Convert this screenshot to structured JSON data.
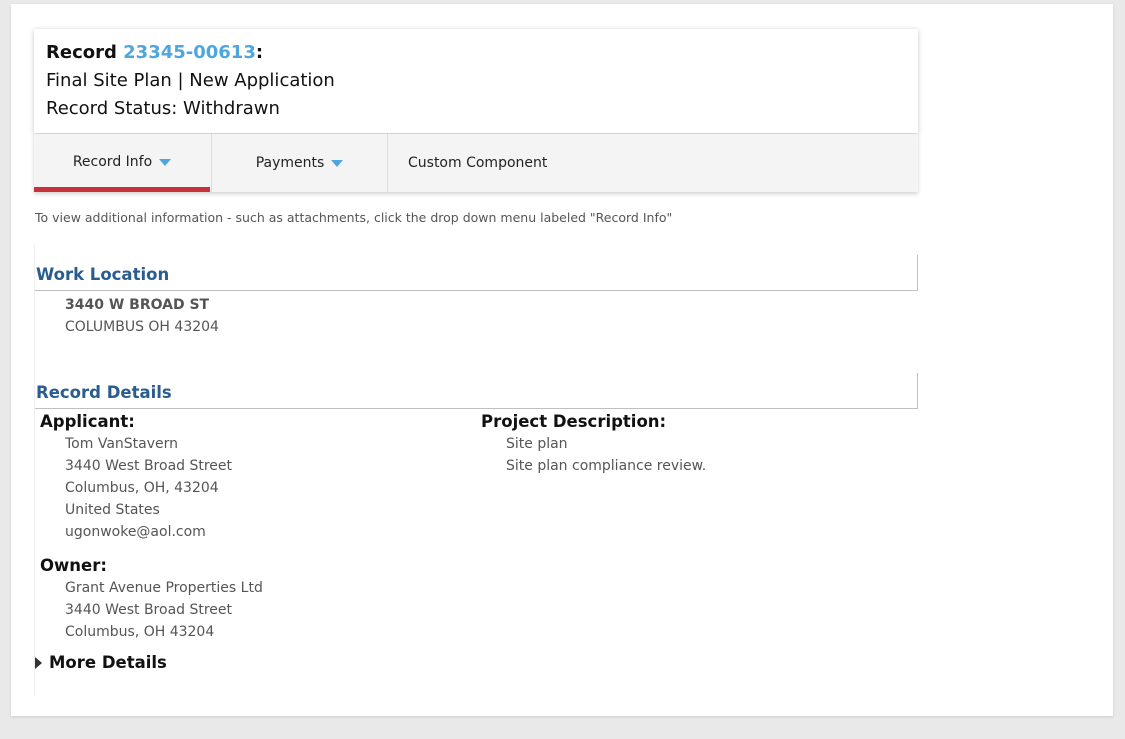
{
  "header": {
    "record_prefix": "Record ",
    "record_number": "23345-00613",
    "record_suffix": ":",
    "record_type": "Final Site Plan | New Application",
    "record_status": "Record Status: Withdrawn"
  },
  "tabs": [
    {
      "label": "Record Info",
      "has_dropdown": true,
      "active": true
    },
    {
      "label": "Payments",
      "has_dropdown": true,
      "active": false
    },
    {
      "label": "Custom Component",
      "has_dropdown": false,
      "active": false
    }
  ],
  "hint": "To view additional information - such as attachments, click the drop down menu labeled \"Record Info\"",
  "work_location": {
    "title": "Work Location",
    "address_line1": "3440 W BROAD ST",
    "address_line2": "COLUMBUS OH 43204"
  },
  "record_details": {
    "title": "Record Details",
    "applicant": {
      "label": "Applicant:",
      "lines": [
        "Tom VanStavern",
        "3440 West Broad Street",
        "Columbus, OH, 43204",
        "United States",
        "ugonwoke@aol.com"
      ]
    },
    "owner": {
      "label": "Owner:",
      "lines": [
        "Grant Avenue Properties Ltd",
        "3440 West Broad Street",
        "Columbus, OH 43204"
      ]
    },
    "project_description": {
      "label": "Project Description:",
      "lines": [
        "Site plan",
        "Site plan compliance review."
      ]
    },
    "more_details": "More Details"
  },
  "colors": {
    "accent_blue": "#4ea6dc",
    "section_title": "#2a5d8e",
    "active_tab_bar": "#c7313b"
  }
}
